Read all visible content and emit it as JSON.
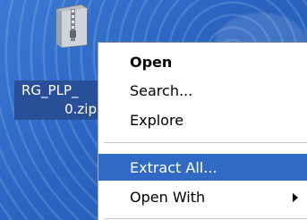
{
  "file": {
    "name_line1": "RG_PLP_",
    "name_line2": "0.zip",
    "icon": "zip-folder-icon"
  },
  "context_menu": {
    "items": [
      {
        "label": "Open",
        "bold": true
      },
      {
        "label": "Search..."
      },
      {
        "label": "Explore"
      },
      {
        "label": "Extract All...",
        "highlighted": true
      },
      {
        "label": "Open With",
        "submenu": true
      }
    ]
  },
  "colors": {
    "desktop": "#2f6dc9",
    "highlight": "#316ac5",
    "label_bg": "#2a4f99"
  }
}
